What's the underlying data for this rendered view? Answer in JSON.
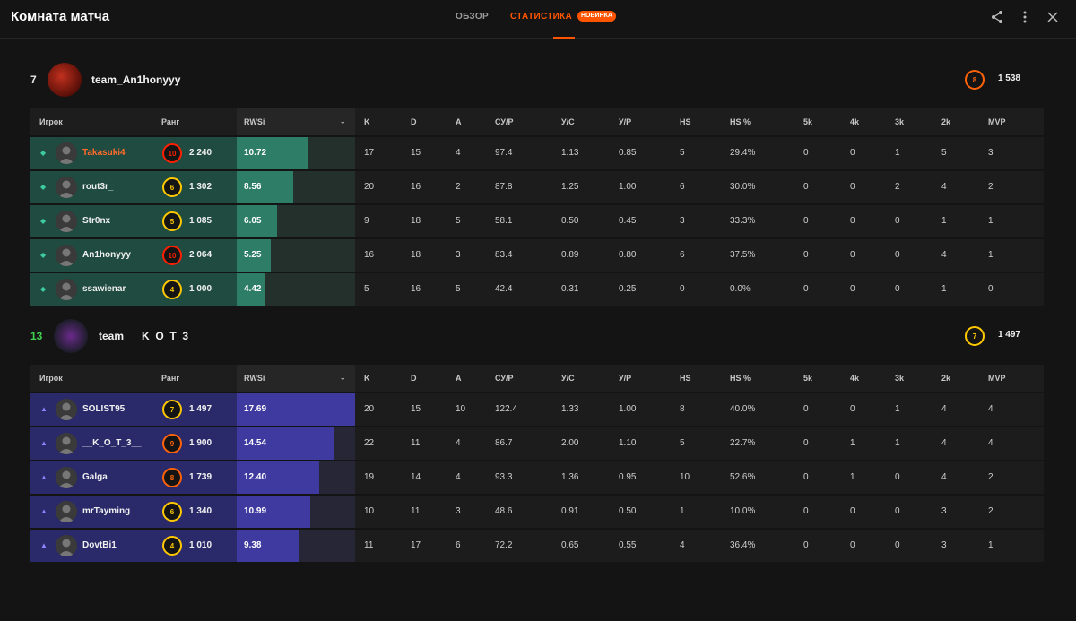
{
  "header": {
    "title": "Комната матча",
    "tabs": [
      {
        "label": "ОБЗОР",
        "active": false
      },
      {
        "label": "СТАТИСТИКА",
        "active": true,
        "badge": "НОВИНКА"
      }
    ],
    "icons": [
      "share-icon",
      "more-vertical-icon",
      "close-icon"
    ]
  },
  "columns": [
    "Игрок",
    "Ранг",
    "RWS",
    "K",
    "D",
    "A",
    "СУ/Р",
    "У/С",
    "У/Р",
    "HS",
    "HS %",
    "5k",
    "4k",
    "3k",
    "2k",
    "MVP"
  ],
  "colors": {
    "accent": "#ff5500",
    "team1": "#2e7d66",
    "team2": "#3f3aa0",
    "win_score": "#3ecf4f"
  },
  "teams": [
    {
      "score": "7",
      "name": "team_An1honyyy",
      "level": "8",
      "elo": "1 538",
      "marker": "◆",
      "players": [
        {
          "name": "Takasuki4",
          "highlight": true,
          "level": "10",
          "elo": "2 240",
          "rws": "10.72",
          "rws_fraction": 0.6,
          "stats": [
            "17",
            "15",
            "4",
            "97.4",
            "1.13",
            "0.85",
            "5",
            "29.4%",
            "0",
            "0",
            "1",
            "5",
            "3"
          ]
        },
        {
          "name": "rout3r_",
          "level": "6",
          "elo": "1 302",
          "rws": "8.56",
          "rws_fraction": 0.48,
          "stats": [
            "20",
            "16",
            "2",
            "87.8",
            "1.25",
            "1.00",
            "6",
            "30.0%",
            "0",
            "0",
            "2",
            "4",
            "2"
          ]
        },
        {
          "name": "Str0nx",
          "level": "5",
          "elo": "1 085",
          "rws": "6.05",
          "rws_fraction": 0.34,
          "stats": [
            "9",
            "18",
            "5",
            "58.1",
            "0.50",
            "0.45",
            "3",
            "33.3%",
            "0",
            "0",
            "0",
            "1",
            "1"
          ]
        },
        {
          "name": "An1honyyy",
          "level": "10",
          "elo": "2 064",
          "rws": "5.25",
          "rws_fraction": 0.29,
          "stats": [
            "16",
            "18",
            "3",
            "83.4",
            "0.89",
            "0.80",
            "6",
            "37.5%",
            "0",
            "0",
            "0",
            "4",
            "1"
          ]
        },
        {
          "name": "ssawienar",
          "level": "4",
          "elo": "1 000",
          "rws": "4.42",
          "rws_fraction": 0.24,
          "stats": [
            "5",
            "16",
            "5",
            "42.4",
            "0.31",
            "0.25",
            "0",
            "0.0%",
            "0",
            "0",
            "0",
            "1",
            "0"
          ]
        }
      ]
    },
    {
      "score": "13",
      "name": "team___K_O_T_3__",
      "level": "7",
      "elo": "1 497",
      "marker": "▲",
      "players": [
        {
          "name": "SOLIST95",
          "level": "7",
          "elo": "1 497",
          "rws": "17.69",
          "rws_fraction": 1.0,
          "stats": [
            "20",
            "15",
            "10",
            "122.4",
            "1.33",
            "1.00",
            "8",
            "40.0%",
            "0",
            "0",
            "1",
            "4",
            "4"
          ]
        },
        {
          "name": "__K_O_T_3__",
          "level": "9",
          "elo": "1 900",
          "rws": "14.54",
          "rws_fraction": 0.82,
          "stats": [
            "22",
            "11",
            "4",
            "86.7",
            "2.00",
            "1.10",
            "5",
            "22.7%",
            "0",
            "1",
            "1",
            "4",
            "4"
          ]
        },
        {
          "name": "Galga",
          "level": "8",
          "elo": "1 739",
          "rws": "12.40",
          "rws_fraction": 0.7,
          "stats": [
            "19",
            "14",
            "4",
            "93.3",
            "1.36",
            "0.95",
            "10",
            "52.6%",
            "0",
            "1",
            "0",
            "4",
            "2"
          ]
        },
        {
          "name": "mrTayming",
          "level": "6",
          "elo": "1 340",
          "rws": "10.99",
          "rws_fraction": 0.62,
          "stats": [
            "10",
            "11",
            "3",
            "48.6",
            "0.91",
            "0.50",
            "1",
            "10.0%",
            "0",
            "0",
            "0",
            "3",
            "2"
          ]
        },
        {
          "name": "DovtBi1",
          "level": "4",
          "elo": "1 010",
          "rws": "9.38",
          "rws_fraction": 0.53,
          "stats": [
            "11",
            "17",
            "6",
            "72.2",
            "0.65",
            "0.55",
            "4",
            "36.4%",
            "0",
            "0",
            "0",
            "3",
            "1"
          ]
        }
      ]
    }
  ]
}
